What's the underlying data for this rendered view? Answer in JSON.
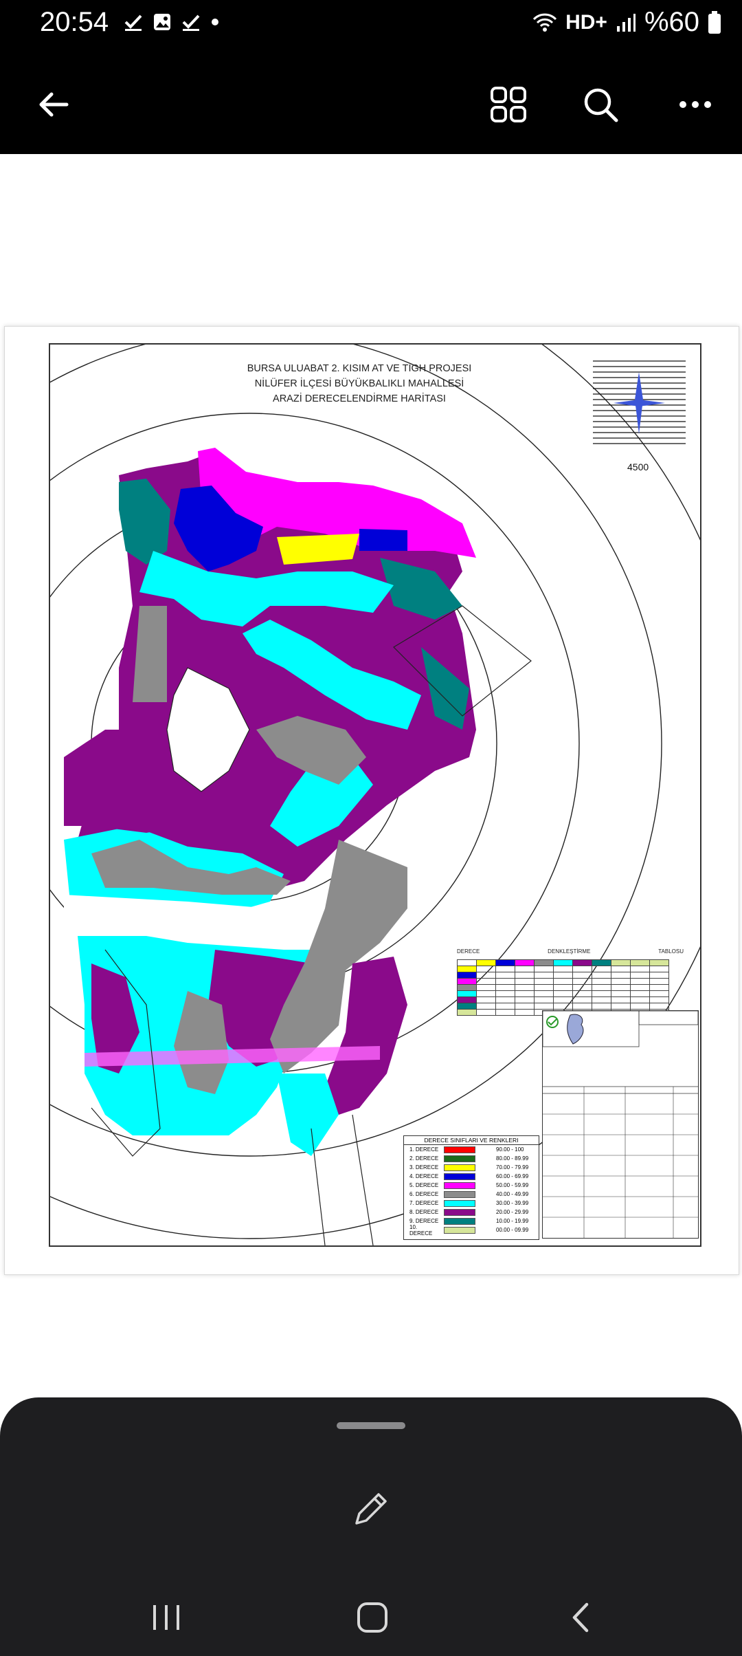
{
  "status_bar": {
    "time": "20:54",
    "left_icons": [
      "check-icon",
      "image-icon",
      "check-icon",
      "dot-icon"
    ],
    "network": "HD+",
    "battery": "%60"
  },
  "app_bar": {
    "back_icon": "back-arrow-icon",
    "grid_icon": "grid-icon",
    "search_icon": "search-icon",
    "more_icon": "more-icon"
  },
  "map": {
    "title_line1": "BURSA ULUABAT 2. KISIM AT VE TIGH PROJESI",
    "title_line2": "NİLÜFER  İLÇESİ BÜYÜKBALIKLI MAHALLESİ",
    "title_line3": "ARAZİ DERECELENDİRME HARİTASI",
    "scale": "4500",
    "table_header": [
      "DERECE",
      "DENKLEŞTİRME",
      "TABLOSU"
    ],
    "legend_title": "DERECE SINIFLARI VE RENKLERI",
    "legend": [
      {
        "label": "1. DERECE",
        "color": "#ff0000",
        "range": "90.00 - 100"
      },
      {
        "label": "2. DERECE",
        "color": "#1b6b1b",
        "range": "80.00 - 89.99"
      },
      {
        "label": "3. DERECE",
        "color": "#ffff00",
        "range": "70.00 - 79.99"
      },
      {
        "label": "4. DERECE",
        "color": "#0000d8",
        "range": "60.00 - 69.99"
      },
      {
        "label": "5. DERECE",
        "color": "#ff00ff",
        "range": "50.00 - 59.99"
      },
      {
        "label": "6. DERECE",
        "color": "#8c8c8c",
        "range": "40.00 - 49.99"
      },
      {
        "label": "7. DERECE",
        "color": "#00ffff",
        "range": "30.00 - 39.99"
      },
      {
        "label": "8. DERECE",
        "color": "#8a0a8a",
        "range": "20.00 - 29.99"
      },
      {
        "label": "9. DERECE",
        "color": "#008080",
        "range": "10.00 - 19.99"
      },
      {
        "label": "10. DERECE",
        "color": "#d6e69a",
        "range": "00.00 - 09.99"
      }
    ]
  },
  "bottom_sheet": {
    "edit_icon": "pencil-icon"
  },
  "nav_bar": {
    "recents_icon": "recents-icon",
    "home_icon": "home-icon",
    "back_icon": "back-chevron-icon"
  }
}
